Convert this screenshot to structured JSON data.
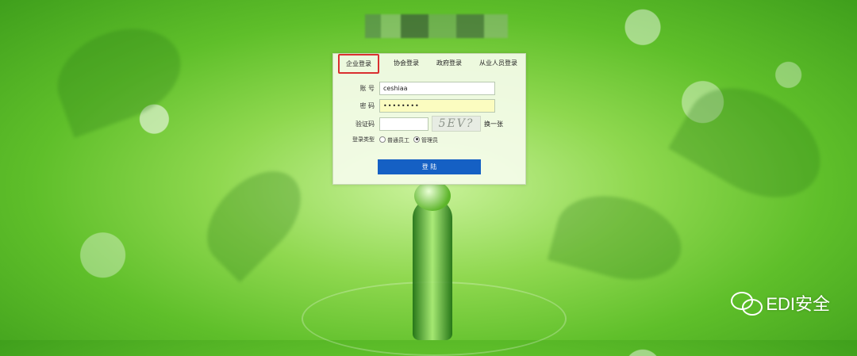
{
  "tabs": [
    "企业登录",
    "协会登录",
    "政府登录",
    "从业人员登录"
  ],
  "form": {
    "account_label": "账 号",
    "account_value": "ceshiaa",
    "password_label": "密 码",
    "password_value": "••••••••",
    "captcha_label": "验证码",
    "captcha_value": "",
    "captcha_text": "5EV?",
    "refresh_label": "换一张",
    "login_type_label": "登录类型",
    "login_types": [
      "普通员工",
      "管理员"
    ],
    "selected_login_type": "管理员",
    "submit_label": "登 陆"
  },
  "watermark": {
    "text": "EDI安全",
    "icon": "wechat-icon"
  },
  "colors": {
    "accent": "#1560c4",
    "highlight": "#d93030",
    "password_bg": "#fbfcc0"
  }
}
